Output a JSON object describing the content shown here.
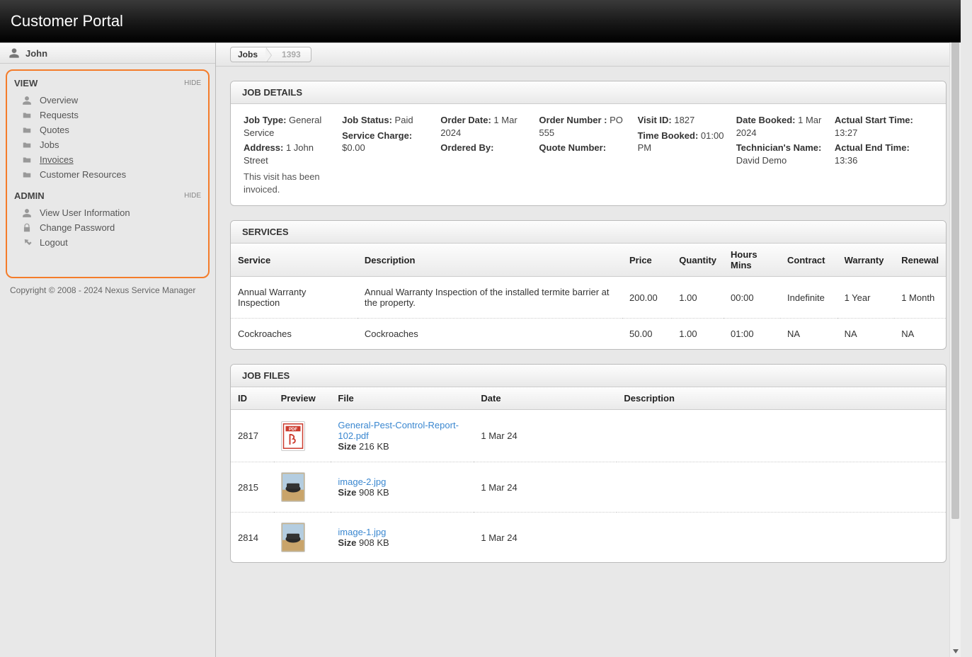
{
  "header": {
    "title": "Customer Portal"
  },
  "user": {
    "name": "John"
  },
  "sidebar": {
    "sections": [
      {
        "title": "VIEW",
        "hide_label": "HIDE",
        "items": [
          {
            "label": "Overview",
            "icon": "user"
          },
          {
            "label": "Requests",
            "icon": "folder"
          },
          {
            "label": "Quotes",
            "icon": "folder"
          },
          {
            "label": "Jobs",
            "icon": "folder"
          },
          {
            "label": "Invoices",
            "icon": "folder",
            "underline": true
          },
          {
            "label": "Customer Resources",
            "icon": "folder"
          }
        ]
      },
      {
        "title": "ADMIN",
        "hide_label": "HIDE",
        "items": [
          {
            "label": "View User Information",
            "icon": "user"
          },
          {
            "label": "Change Password",
            "icon": "lock"
          },
          {
            "label": "Logout",
            "icon": "arrow"
          }
        ]
      }
    ]
  },
  "breadcrumb": {
    "root": "Jobs",
    "current": "1393"
  },
  "job_details": {
    "title": "JOB DETAILS",
    "cols": [
      [
        {
          "k": "Job Type:",
          "v": "General Service"
        },
        {
          "k": "Address:",
          "v": "1 John Street"
        }
      ],
      [
        {
          "k": "Job Status:",
          "v": "Paid"
        },
        {
          "k": "Service Charge:",
          "v": "$0.00"
        }
      ],
      [
        {
          "k": "Order Date:",
          "v": "1 Mar 2024"
        },
        {
          "k": "Ordered By:",
          "v": ""
        }
      ],
      [
        {
          "k": "Order Number :",
          "v": "PO 555"
        },
        {
          "k": "Quote Number:",
          "v": ""
        }
      ],
      [
        {
          "k": "Visit ID:",
          "v": "1827"
        },
        {
          "k": "Time Booked:",
          "v": "01:00 PM"
        }
      ],
      [
        {
          "k": "Date Booked:",
          "v": "1 Mar 2024"
        },
        {
          "k": "Technician's Name:",
          "v": "David Demo"
        }
      ],
      [
        {
          "k": "Actual Start Time:",
          "v": "13:27"
        },
        {
          "k": "Actual End Time:",
          "v": "13:36"
        }
      ]
    ],
    "note": "This visit has been invoiced."
  },
  "services": {
    "title": "SERVICES",
    "headers": [
      "Service",
      "Description",
      "Price",
      "Quantity",
      "Hours Mins",
      "Contract",
      "Warranty",
      "Renewal"
    ],
    "rows": [
      {
        "service": "Annual Warranty Inspection",
        "description": "Annual Warranty Inspection of the installed termite barrier at the property.",
        "price": "200.00",
        "quantity": "1.00",
        "hours": "00:00",
        "contract": "Indefinite",
        "warranty": "1 Year",
        "renewal": "1 Month"
      },
      {
        "service": "Cockroaches",
        "description": "Cockroaches",
        "price": "50.00",
        "quantity": "1.00",
        "hours": "01:00",
        "contract": "NA",
        "warranty": "NA",
        "renewal": "NA"
      }
    ]
  },
  "job_files": {
    "title": "JOB FILES",
    "headers": [
      "ID",
      "Preview",
      "File",
      "Date",
      "Description"
    ],
    "size_label": "Size",
    "rows": [
      {
        "id": "2817",
        "type": "pdf",
        "filename": "General-Pest-Control-Report-102.pdf",
        "size": "216 KB",
        "date": "1 Mar 24",
        "description": ""
      },
      {
        "id": "2815",
        "type": "img",
        "filename": "image-2.jpg",
        "size": "908 KB",
        "date": "1 Mar 24",
        "description": ""
      },
      {
        "id": "2814",
        "type": "img",
        "filename": "image-1.jpg",
        "size": "908 KB",
        "date": "1 Mar 24",
        "description": ""
      }
    ]
  },
  "footer": {
    "copyright": "Copyright © 2008 - 2024 Nexus Service Manager"
  }
}
